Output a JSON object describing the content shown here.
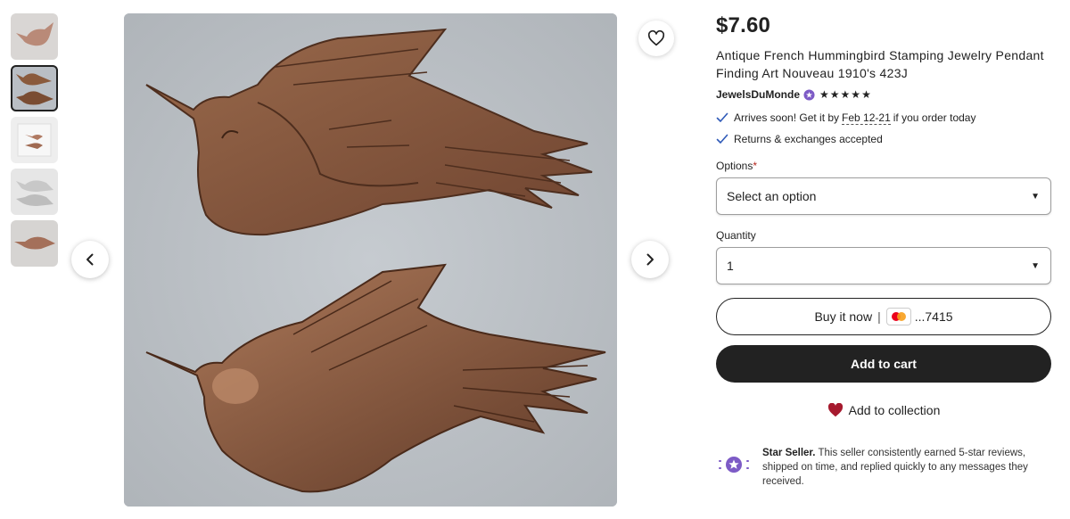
{
  "listing": {
    "price": "$7.60",
    "title": "Antique French Hummingbird Stamping Jewelry Pendant Finding Art Nouveau 1910's 423J",
    "seller_name": "JewelsDuMonde",
    "rating_stars": "★★★★★",
    "rating": 5
  },
  "perks": {
    "arrival_prefix": "Arrives soon! Get it by",
    "arrival_date": "Feb 12-21",
    "arrival_suffix": "if you order today",
    "returns": "Returns & exchanges accepted"
  },
  "options": {
    "label": "Options",
    "required_mark": "*",
    "value": "Select an option"
  },
  "quantity": {
    "label": "Quantity",
    "value": "1"
  },
  "actions": {
    "buy_now": "Buy it now",
    "separator": "|",
    "card_last4": "...7415",
    "add_to_cart": "Add to cart",
    "add_to_collection": "Add to collection"
  },
  "star_seller": {
    "title": "Star Seller.",
    "text": "This seller consistently earned 5-star reviews, shipped on time, and replied quickly to any messages they received."
  },
  "gallery": {
    "thumbnail_count": 5,
    "active_index": 1
  },
  "colors": {
    "primary": "#222222",
    "badge_purple": "#7d5bc6",
    "check_blue": "#2f5ab8",
    "heart_red": "#a61a2e",
    "bronze": "#8a5a3c"
  }
}
